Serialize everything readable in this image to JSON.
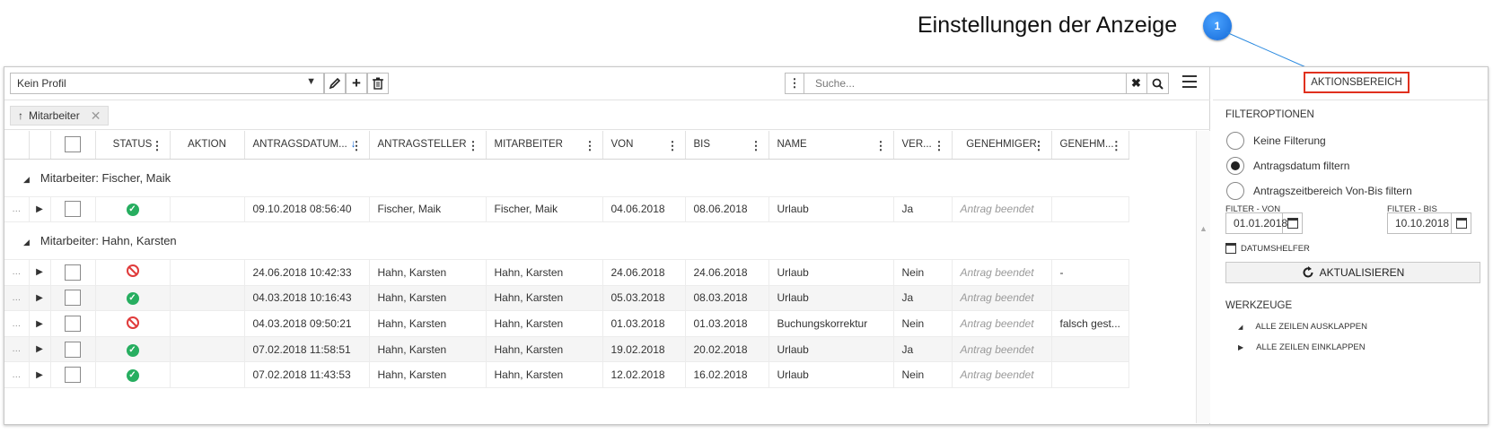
{
  "callout": {
    "text": "Einstellungen der Anzeige",
    "badge": "1"
  },
  "toolbar": {
    "profile_value": "Kein Profil",
    "search_placeholder": "Suche...",
    "icons": [
      "edit-icon",
      "plus-icon",
      "trash-icon",
      "more-vertical-icon",
      "clear-icon",
      "search-icon",
      "menu-icon"
    ]
  },
  "groupby": {
    "label": "Mitarbeiter"
  },
  "grid": {
    "columns": [
      "STATUS",
      "AKTION",
      "ANTRAGSDATUM...",
      "ANTRAGSTELLER",
      "MITARBEITER",
      "VON",
      "BIS",
      "NAME",
      "VER...",
      "GENEHMIGER",
      "GENEHM..."
    ],
    "groups": [
      {
        "title": "Mitarbeiter: Fischer, Maik",
        "rows": [
          {
            "status": "ok",
            "datum": "09.10.2018 08:56:40",
            "antragsteller": "Fischer, Maik",
            "mitarbeiter": "Fischer, Maik",
            "von": "04.06.2018",
            "bis": "08.06.2018",
            "name": "Urlaub",
            "ver": "Ja",
            "genehmiger": "Antrag beendet",
            "genehm": ""
          }
        ]
      },
      {
        "title": "Mitarbeiter: Hahn, Karsten",
        "rows": [
          {
            "status": "denied",
            "datum": "24.06.2018 10:42:33",
            "antragsteller": "Hahn, Karsten",
            "mitarbeiter": "Hahn, Karsten",
            "von": "24.06.2018",
            "bis": "24.06.2018",
            "name": "Urlaub",
            "ver": "Nein",
            "genehmiger": "Antrag beendet",
            "genehm": "-"
          },
          {
            "status": "ok",
            "datum": "04.03.2018 10:16:43",
            "antragsteller": "Hahn, Karsten",
            "mitarbeiter": "Hahn, Karsten",
            "von": "05.03.2018",
            "bis": "08.03.2018",
            "name": "Urlaub",
            "ver": "Ja",
            "genehmiger": "Antrag beendet",
            "genehm": ""
          },
          {
            "status": "denied",
            "datum": "04.03.2018 09:50:21",
            "antragsteller": "Hahn, Karsten",
            "mitarbeiter": "Hahn, Karsten",
            "von": "01.03.2018",
            "bis": "01.03.2018",
            "name": "Buchungskorrektur",
            "ver": "Nein",
            "genehmiger": "Antrag beendet",
            "genehm": "falsch gest..."
          },
          {
            "status": "ok",
            "datum": "07.02.2018 11:58:51",
            "antragsteller": "Hahn, Karsten",
            "mitarbeiter": "Hahn, Karsten",
            "von": "19.02.2018",
            "bis": "20.02.2018",
            "name": "Urlaub",
            "ver": "Ja",
            "genehmiger": "Antrag beendet",
            "genehm": ""
          },
          {
            "status": "ok",
            "datum": "07.02.2018 11:43:53",
            "antragsteller": "Hahn, Karsten",
            "mitarbeiter": "Hahn, Karsten",
            "von": "12.02.2018",
            "bis": "16.02.2018",
            "name": "Urlaub",
            "ver": "Nein",
            "genehmiger": "Antrag beendet",
            "genehm": ""
          }
        ]
      }
    ]
  },
  "side": {
    "header_button": "AKTIONSBEREICH",
    "filter_title": "FILTEROPTIONEN",
    "radios": [
      {
        "label": "Keine Filterung",
        "selected": false
      },
      {
        "label": "Antragsdatum filtern",
        "selected": true
      },
      {
        "label": "Antragszeitbereich Von-Bis filtern",
        "selected": false
      }
    ],
    "filter_von_label": "FILTER - VON",
    "filter_von_value": "01.01.2018",
    "filter_bis_label": "FILTER - BIS",
    "filter_bis_value": "10.10.2018",
    "datumshelfer": "DATUMSHELFER",
    "refresh": "AKTUALISIEREN",
    "tools_title": "WERKZEUGE",
    "expand_all": "ALLE ZEILEN AUSKLAPPEN",
    "collapse_all": "ALLE ZEILEN EINKLAPPEN"
  },
  "colors": {
    "accent_red": "#e0301e",
    "callout_blue": "#1469d8",
    "status_ok": "#27ae60",
    "status_denied": "#e03b3b"
  }
}
